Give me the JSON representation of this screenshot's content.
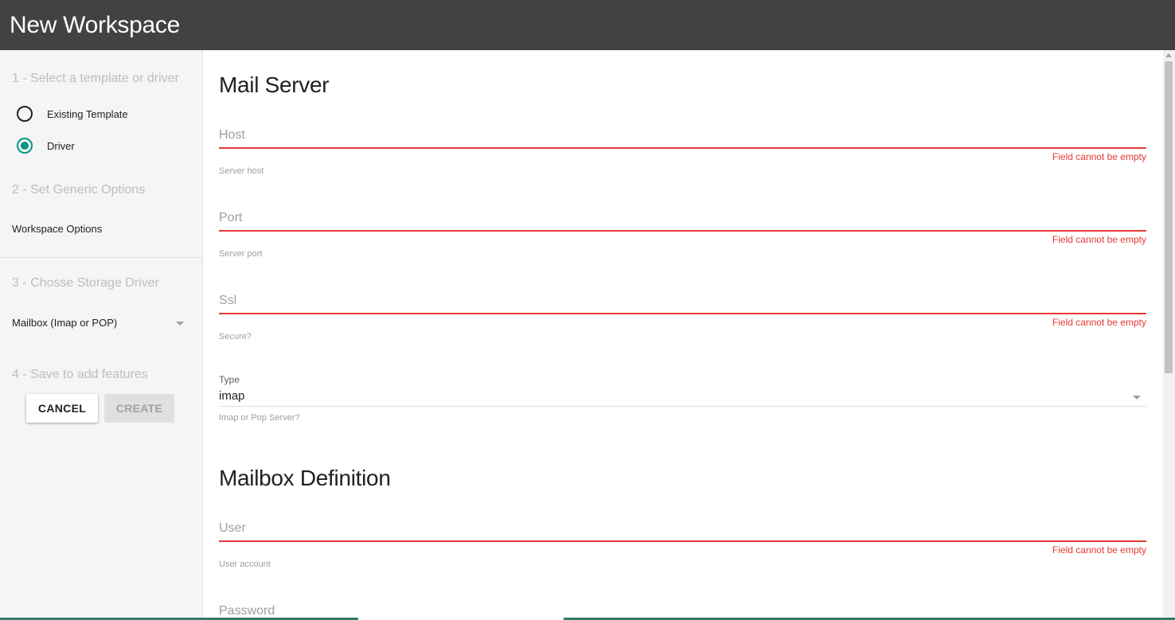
{
  "header": {
    "title": "New Workspace"
  },
  "sidebar": {
    "step1": "1 - Select a template or driver",
    "radios": [
      {
        "label": "Existing Template",
        "checked": false
      },
      {
        "label": "Driver",
        "checked": true
      }
    ],
    "step2": "2 - Set Generic Options",
    "workspace_options": "Workspace Options",
    "step3": "3 - Chosse Storage Driver",
    "storage_driver": "Mailbox (Imap or POP)",
    "step4": "4 - Save to add features",
    "cancel_label": "CANCEL",
    "create_label": "CREATE"
  },
  "main": {
    "section1_title": "Mail Server",
    "host": {
      "placeholder": "Host",
      "error": "Field cannot be empty",
      "hint": "Server host"
    },
    "port": {
      "placeholder": "Port",
      "error": "Field cannot be empty",
      "hint": "Server port"
    },
    "ssl": {
      "placeholder": "Ssl",
      "error": "Field cannot be empty",
      "hint": "Secure?"
    },
    "type": {
      "label": "Type",
      "value": "imap",
      "hint": "Imap or Pop Server?"
    },
    "section2_title": "Mailbox Definition",
    "user": {
      "placeholder": "User",
      "error": "Field cannot be empty",
      "hint": "User account"
    },
    "password": {
      "placeholder": "Password"
    }
  },
  "colors": {
    "accent": "#009688",
    "error": "#e53935",
    "header_bg": "#424242"
  },
  "icons": [
    "dropdown-caret-icon",
    "radio-icon",
    "scroll-up-arrow-icon"
  ]
}
